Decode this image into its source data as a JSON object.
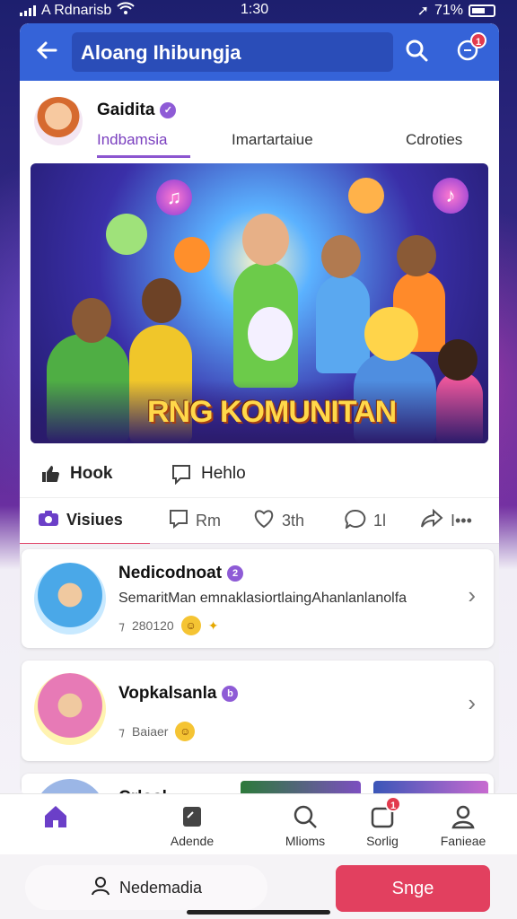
{
  "status_bar": {
    "carrier": "A Rdnarisb",
    "time": "1:30",
    "battery": "71%"
  },
  "header": {
    "title": "Aloang Ihibungja",
    "notification_count": "1"
  },
  "profile": {
    "name": "Gaidita",
    "tabs": [
      {
        "label": "Indbamsia",
        "active": true
      },
      {
        "label": "Imartartaiue",
        "active": false
      },
      {
        "label": "Cdroties",
        "active": false
      }
    ]
  },
  "banner": {
    "title": "RNG KOMUNITAN"
  },
  "actions_primary": [
    {
      "label": "Hook",
      "icon": "thumbs-up-icon"
    },
    {
      "label": "Hehlo",
      "icon": "comment-icon"
    }
  ],
  "actions_secondary": [
    {
      "label": "Visiues",
      "icon": "camera-icon",
      "active": true
    },
    {
      "label": "Rm",
      "icon": "chat-icon"
    },
    {
      "label": "3th",
      "icon": "heart-icon"
    },
    {
      "label": "1l",
      "icon": "speech-icon"
    },
    {
      "label": "I•••",
      "icon": "share-icon"
    }
  ],
  "list": [
    {
      "title": "Nedicodnoat",
      "badge": "2",
      "desc": "SemaritMan emnaklasiortlaingAhanlanlanolfa",
      "meta": "280120"
    },
    {
      "title": "Vopkalsanla",
      "badge": "b",
      "desc": "",
      "meta": "Baiaer"
    },
    {
      "title": "Crlosl",
      "badge": "",
      "desc": "",
      "meta": ""
    }
  ],
  "bottom_nav": [
    {
      "label": "",
      "icon": "home-icon",
      "active": true
    },
    {
      "label": "Adende",
      "icon": "note-icon"
    },
    {
      "label": "Mlioms",
      "icon": "search-icon"
    },
    {
      "label": "Sorlig",
      "icon": "inbox-icon",
      "badge": "1"
    },
    {
      "label": "Fanieae",
      "icon": "profile-icon"
    }
  ],
  "footer": {
    "secondary_label": "Nedemadia",
    "cta_label": "Snge"
  },
  "colors": {
    "primary": "#3563d8",
    "accent": "#8c56d0",
    "cta": "#e2405f"
  }
}
